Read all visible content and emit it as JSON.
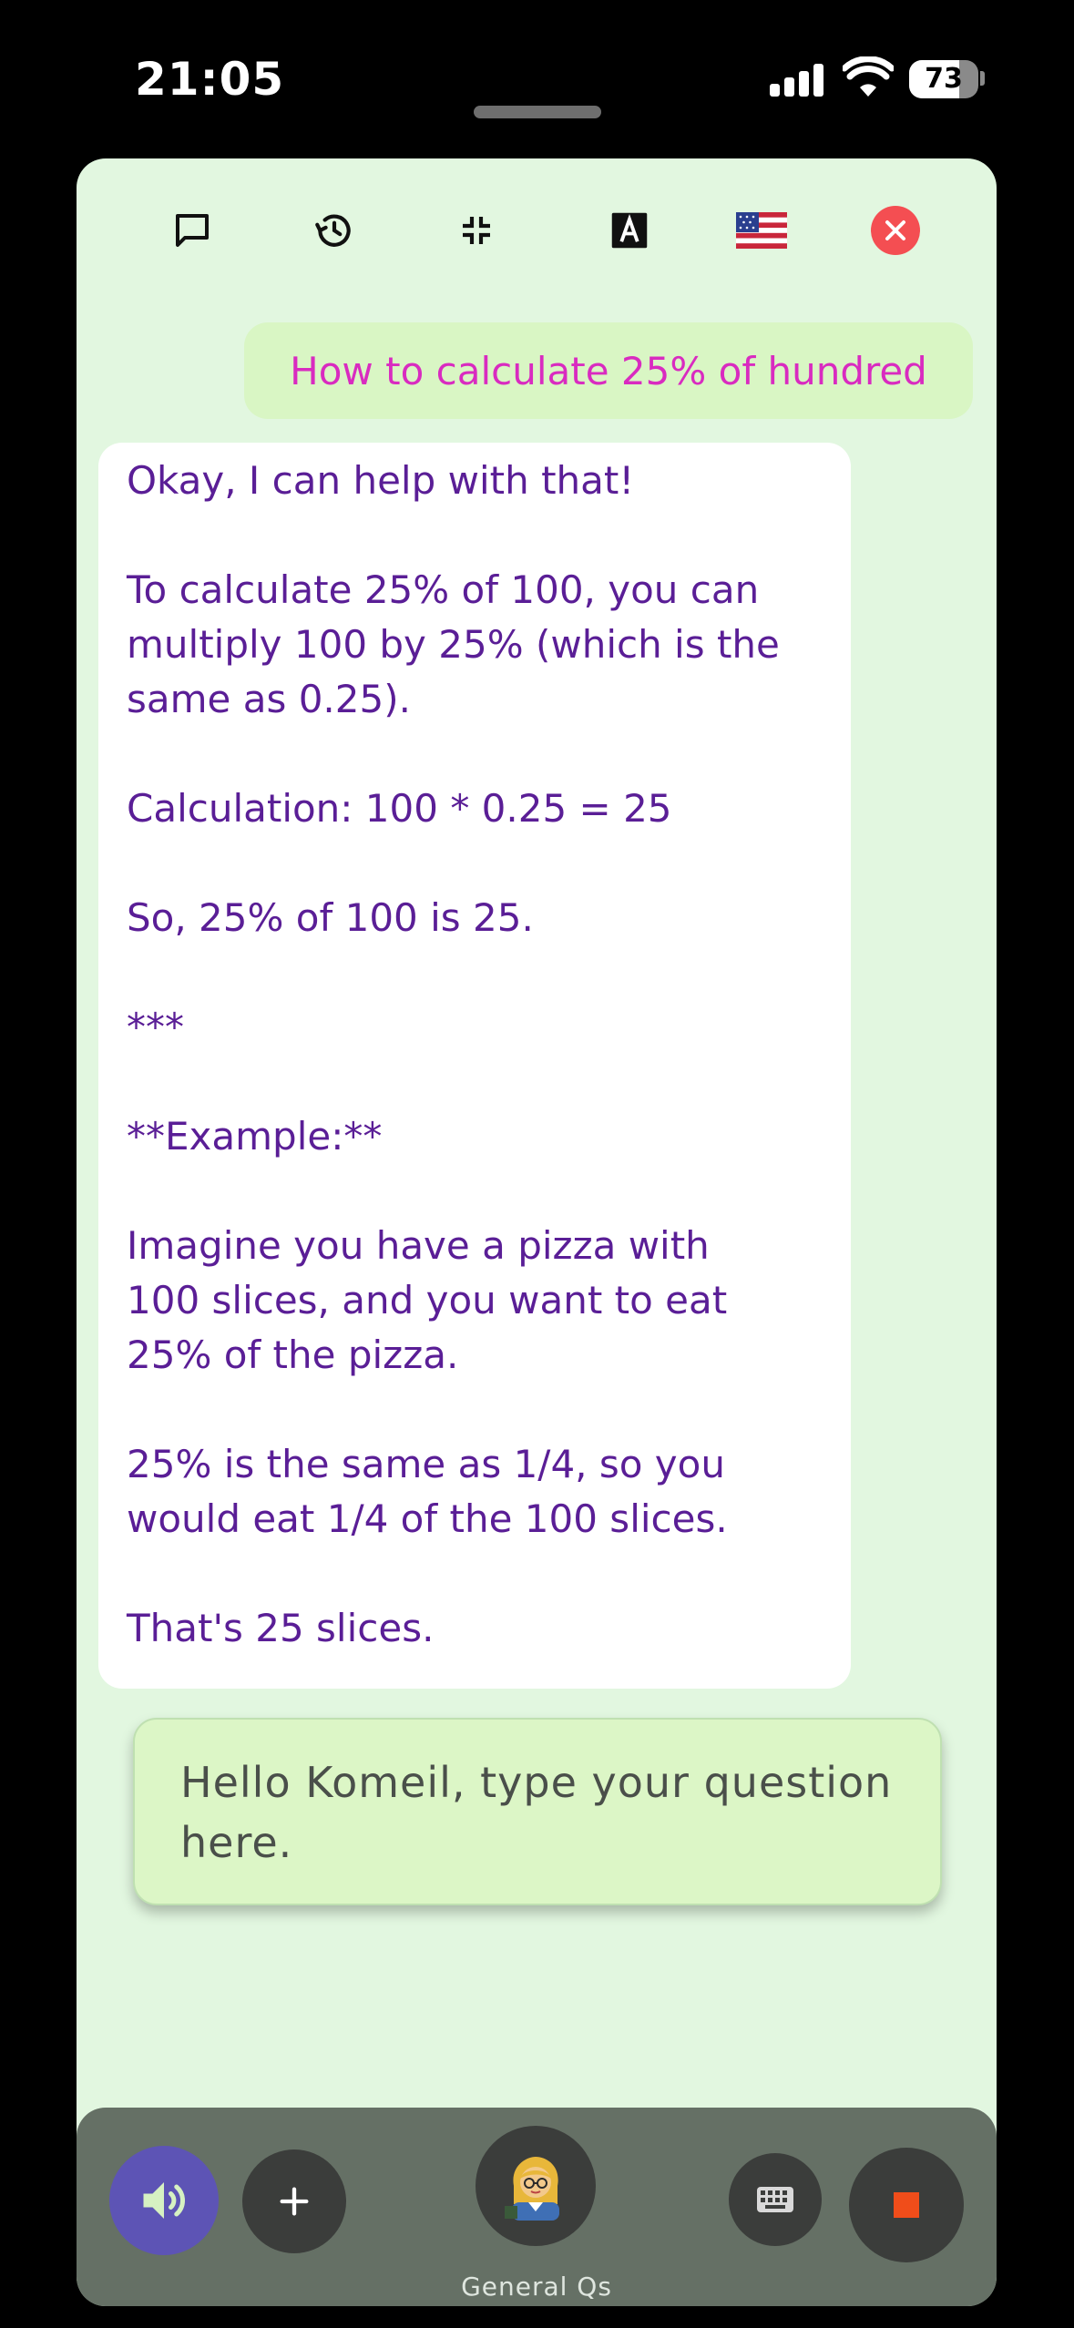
{
  "status_bar": {
    "time": "21:05",
    "battery": "73",
    "battery_level": 0.73
  },
  "toolbar": {
    "icons": [
      "chat-bubble-icon",
      "history-icon",
      "collapse-icon",
      "font-size-icon",
      "us-flag-icon",
      "close-icon"
    ],
    "close_color": "#f44e52"
  },
  "conversation": {
    "user_message": "How to calculate 25% of hundred",
    "bot_lines": [
      "Okay, I can help with that!",
      "",
      "To calculate 25% of 100, you can",
      "multiply 100 by 25% (which is the",
      "same as 0.25).",
      "",
      "Calculation: 100 * 0.25 = 25",
      "",
      "So, 25% of 100 is 25.",
      "",
      "***",
      "",
      "**Example:**",
      "",
      "Imagine you have a pizza with",
      "100 slices, and you want to eat",
      "25% of the pizza.",
      "",
      "25% is the same as 1/4, so you",
      "would eat 1/4 of the 100 slices.",
      "",
      "That's 25 slices."
    ]
  },
  "input": {
    "placeholder": "Hello Komeil, type your question here."
  },
  "bottom_bar": {
    "mode_label": "General Qs",
    "icons": [
      "speaker-icon",
      "plus-icon",
      "teacher-avatar-icon",
      "keyboard-icon",
      "stop-icon"
    ],
    "speaker_color": "#5d54b5",
    "stop_color": "#f04d1a"
  }
}
